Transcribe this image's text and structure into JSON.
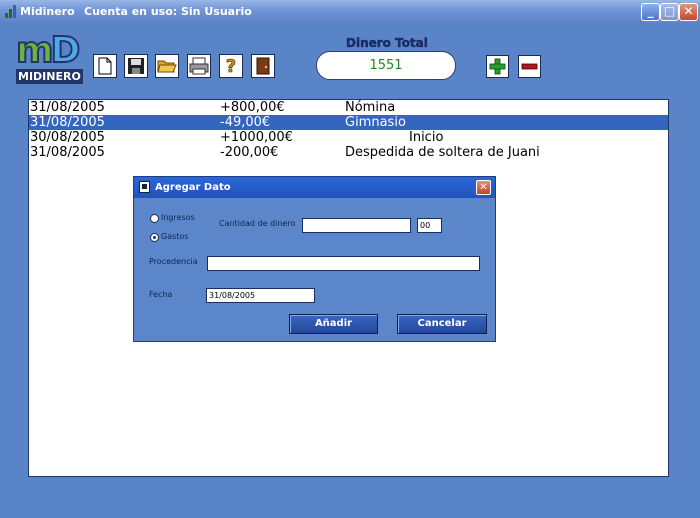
{
  "window": {
    "app_name": "Midinero",
    "account_text": "Cuenta en uso: Sin Usuario",
    "minimize": "_",
    "maximize": "□",
    "close": "✕"
  },
  "logo": {
    "letter_m": "m",
    "letter_d": "D",
    "text": "MIDINERO"
  },
  "toolbar": {
    "tools": [
      {
        "name": "new-document-icon"
      },
      {
        "name": "save-icon"
      },
      {
        "name": "open-folder-icon"
      },
      {
        "name": "print-icon"
      },
      {
        "name": "help-icon"
      },
      {
        "name": "exit-door-icon"
      }
    ],
    "help_symbol": "?"
  },
  "total": {
    "label": "Dinero Total",
    "value": "1551"
  },
  "colors": {
    "accent": "#3266bf",
    "add": "#2a9d2a",
    "remove": "#b1141c",
    "total_text": "#1a8a1a"
  },
  "entries": [
    {
      "date": "31/08/2005",
      "amount": "+800,00€",
      "description": "Nómina",
      "selected": false
    },
    {
      "date": "31/08/2005",
      "amount": "-49,00€",
      "description": "Gimnasio",
      "selected": true
    },
    {
      "date": "30/08/2005",
      "amount": "+1000,00€",
      "description": "Inicio",
      "selected": false
    },
    {
      "date": "31/08/2005",
      "amount": "-200,00€",
      "description": "Despedida de soltera de Juani",
      "selected": false
    }
  ],
  "dialog": {
    "title": "Agregar Dato",
    "close": "✕",
    "radio_ingresos": "Ingresos",
    "radio_gastos": "Gastos",
    "amount_label": "Cantidad de dinero",
    "amount_value": "",
    "cents_value": "00",
    "origin_label": "Procedencia",
    "origin_value": "",
    "date_label": "Fecha",
    "date_value": "31/08/2005",
    "add_button": "Añadir",
    "cancel_button": "Cancelar"
  }
}
